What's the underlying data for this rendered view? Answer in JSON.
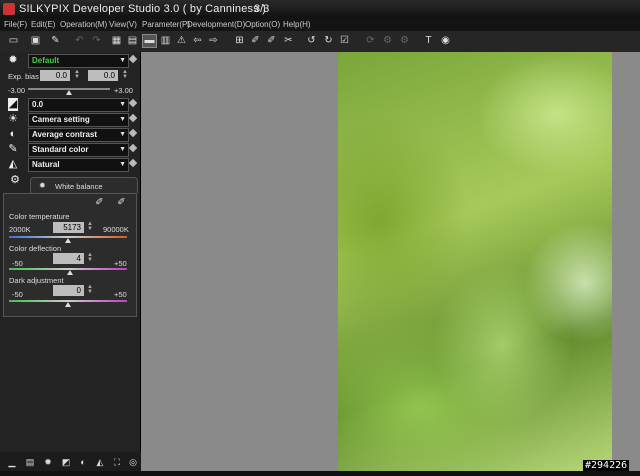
{
  "window": {
    "title": "SILKYPIX Developer Studio 3.0 ( by Canniness )",
    "page_indicator": "3/3"
  },
  "menu": [
    "File(F)",
    "Edit(E)",
    "Operation(M)",
    "View(V)",
    "Parameter(P)",
    "Development(D)",
    "Option(O)",
    "Help(H)"
  ],
  "left_panel": {
    "taste": "Default",
    "exposure": {
      "label": "Exp. bias",
      "value1": "0.0",
      "value2": "0.0",
      "min": "-3.00",
      "max": "+3.00"
    },
    "rows": [
      "0.0",
      "Camera setting",
      "Average contrast",
      "Standard color",
      "Natural"
    ],
    "wb_tab": "White balance",
    "color_temp": {
      "label": "Color temperature",
      "min": "2000K",
      "value": "5173",
      "max": "90000K"
    },
    "deflection": {
      "label": "Color deflection",
      "min": "-50",
      "value": "4",
      "max": "+50"
    },
    "dark": {
      "label": "Dark adjustment",
      "min": "-50",
      "value": "0",
      "max": "+50"
    }
  },
  "watermark": "#294226",
  "colors": {
    "accent_green": "#3fd23f",
    "panel": "#232323"
  }
}
